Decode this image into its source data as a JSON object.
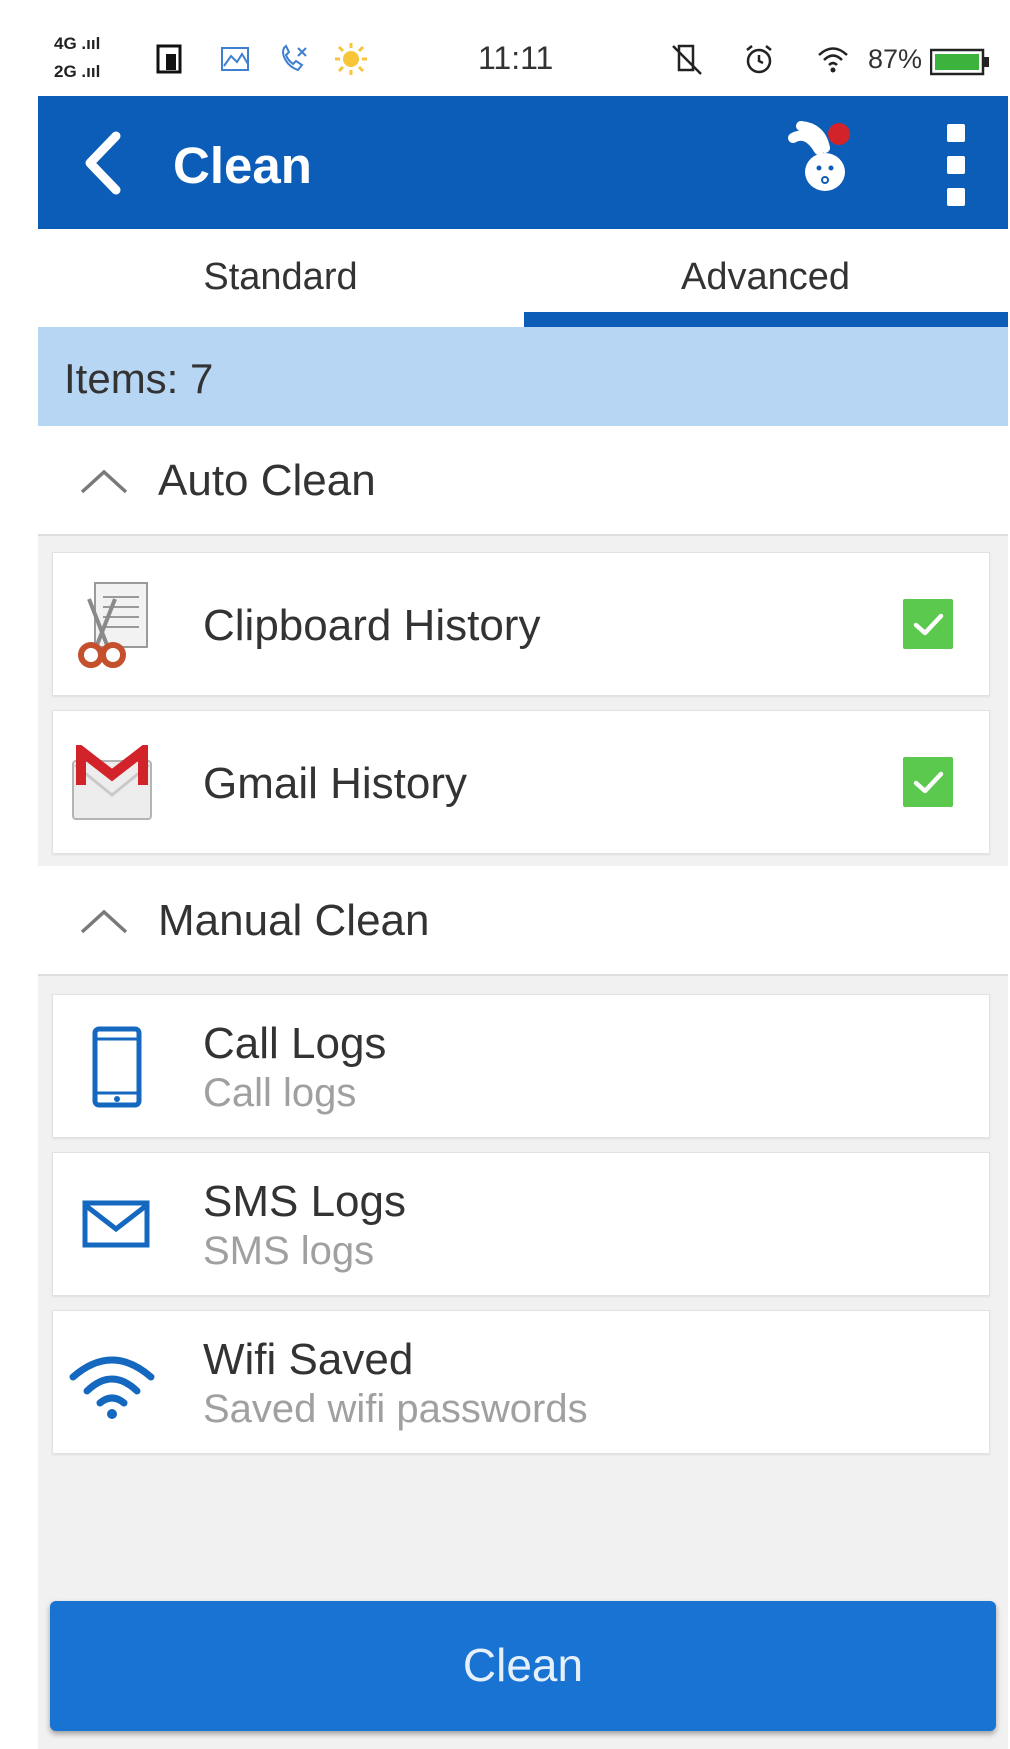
{
  "status_bar": {
    "signal_1": "4G .ııl",
    "signal_2": "2G .ııl",
    "time": "11:11",
    "battery": "87%"
  },
  "app_bar": {
    "title": "Clean"
  },
  "tabs": [
    {
      "label": "Standard",
      "selected": false
    },
    {
      "label": "Advanced",
      "selected": true
    }
  ],
  "items_bar": {
    "text": "Items: 7"
  },
  "sections": {
    "auto": {
      "label": "Auto Clean",
      "items": [
        {
          "title": "Clipboard History",
          "icon": "clipboard-scissors-icon",
          "checked": true
        },
        {
          "title": "Gmail History",
          "icon": "gmail-icon",
          "checked": true
        }
      ]
    },
    "manual": {
      "label": "Manual Clean",
      "items": [
        {
          "title": "Call Logs",
          "subtitle": "Call logs",
          "icon": "phone-icon"
        },
        {
          "title": "SMS Logs",
          "subtitle": "SMS logs",
          "icon": "envelope-icon"
        },
        {
          "title": "Wifi Saved",
          "subtitle": "Saved wifi passwords",
          "icon": "wifi-icon"
        }
      ]
    }
  },
  "clean_button": {
    "label": "Clean"
  },
  "colors": {
    "primary": "#0c5db8",
    "button": "#1873d3",
    "items_bar": "#b7d6f4",
    "check": "#5bc94e"
  }
}
